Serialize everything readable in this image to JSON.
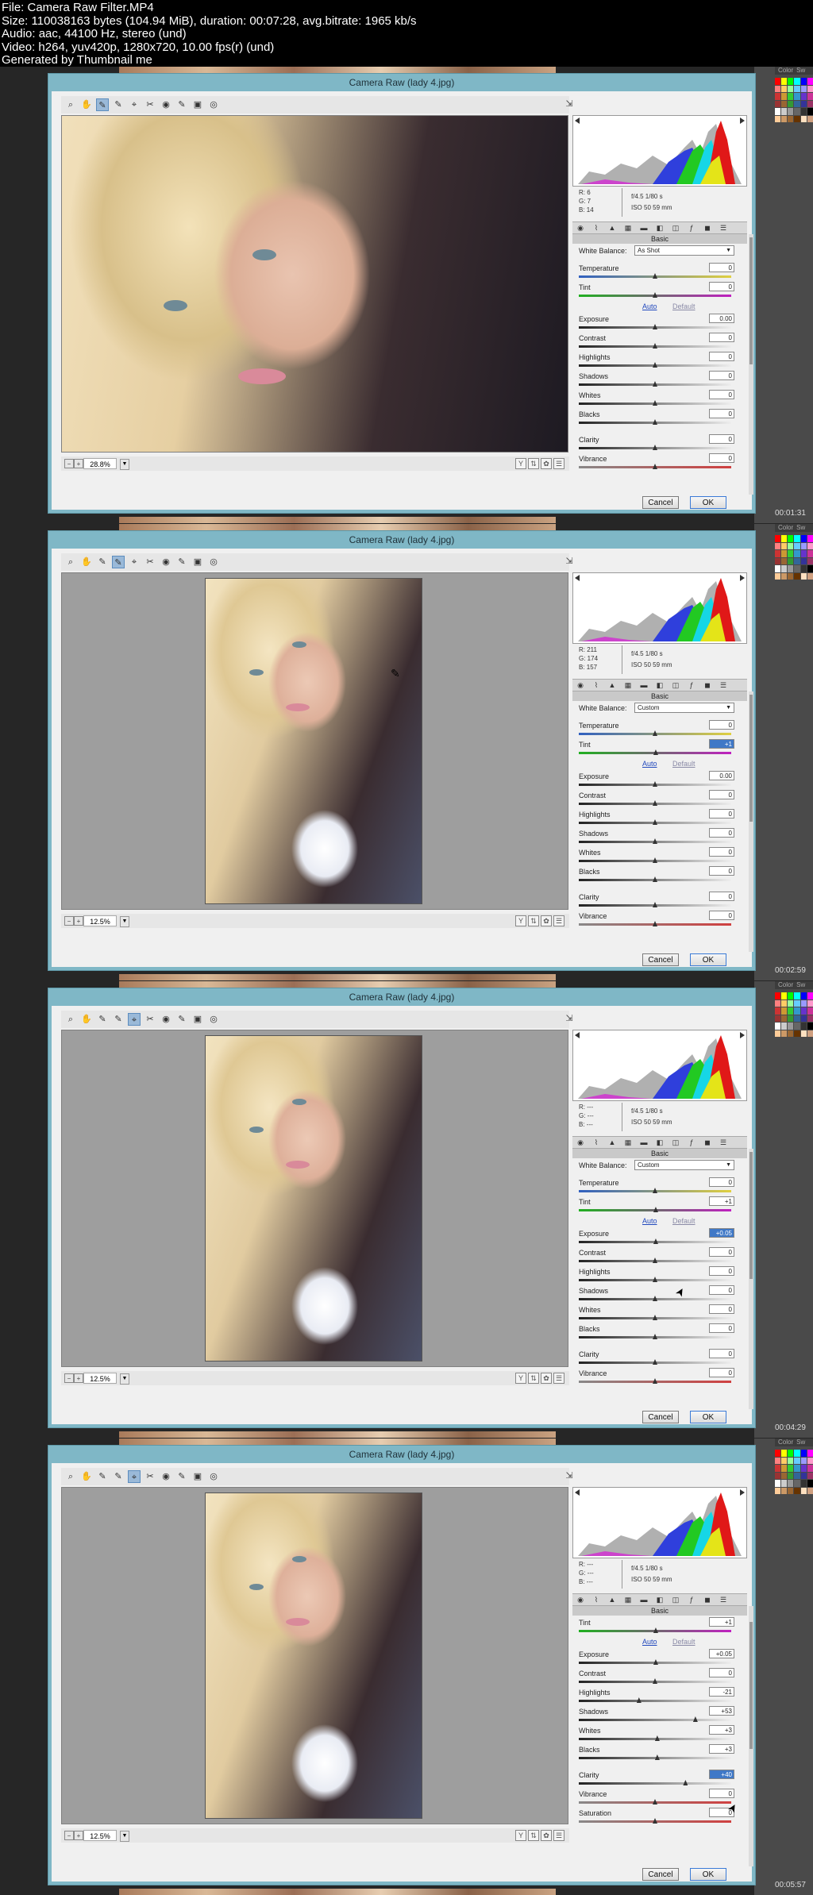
{
  "info": {
    "line1": "File: Camera Raw Filter.MP4",
    "line2": "Size: 110038163 bytes (104.94 MiB), duration: 00:07:28, avg.bitrate: 1965 kb/s",
    "line3": "Audio: aac, 44100 Hz, stereo (und)",
    "line4": "Video: h264, yuv420p, 1280x720, 10.00 fps(r) (und)",
    "line5": "Generated by Thumbnail me"
  },
  "ps_tabs": {
    "color": "Color",
    "swatches": "Sw"
  },
  "frames": [
    {
      "title": "Camera Raw (lady 4.jpg)",
      "timestamp": "00:01:31",
      "zoom": "28.8%",
      "rgb": {
        "r": "R: 6",
        "g": "G: 7",
        "b": "B: 14"
      },
      "cam": {
        "line1": "f/4.5  1/80 s",
        "line2": "ISO 50  59 mm"
      },
      "section": "Basic",
      "white_balance": {
        "label": "White Balance:",
        "value": "As Shot"
      },
      "auto": "Auto",
      "default": "Default",
      "rows": [
        {
          "label": "Temperature",
          "value": "0"
        },
        {
          "label": "Tint",
          "value": "0"
        },
        {
          "label": "Exposure",
          "value": "0.00"
        },
        {
          "label": "Contrast",
          "value": "0"
        },
        {
          "label": "Highlights",
          "value": "0"
        },
        {
          "label": "Shadows",
          "value": "0"
        },
        {
          "label": "Whites",
          "value": "0"
        },
        {
          "label": "Blacks",
          "value": "0"
        },
        {
          "label": "Clarity",
          "value": "0"
        },
        {
          "label": "Vibrance",
          "value": "0"
        }
      ],
      "cancel": "Cancel",
      "ok": "OK"
    },
    {
      "title": "Camera Raw (lady 4.jpg)",
      "timestamp": "00:02:59",
      "zoom": "12.5%",
      "rgb": {
        "r": "R: 211",
        "g": "G: 174",
        "b": "B: 157"
      },
      "cam": {
        "line1": "f/4.5  1/80 s",
        "line2": "ISO 50  59 mm"
      },
      "section": "Basic",
      "white_balance": {
        "label": "White Balance:",
        "value": "Custom"
      },
      "auto": "Auto",
      "default": "Default",
      "rows": [
        {
          "label": "Temperature",
          "value": "0"
        },
        {
          "label": "Tint",
          "value": "+1"
        },
        {
          "label": "Exposure",
          "value": "0.00"
        },
        {
          "label": "Contrast",
          "value": "0"
        },
        {
          "label": "Highlights",
          "value": "0"
        },
        {
          "label": "Shadows",
          "value": "0"
        },
        {
          "label": "Whites",
          "value": "0"
        },
        {
          "label": "Blacks",
          "value": "0"
        },
        {
          "label": "Clarity",
          "value": "0"
        },
        {
          "label": "Vibrance",
          "value": "0"
        }
      ],
      "cancel": "Cancel",
      "ok": "OK"
    },
    {
      "title": "Camera Raw (lady 4.jpg)",
      "timestamp": "00:04:29",
      "zoom": "12.5%",
      "rgb": {
        "r": "R: ---",
        "g": "G: ---",
        "b": "B: ---"
      },
      "cam": {
        "line1": "f/4.5  1/80 s",
        "line2": "ISO 50  59 mm"
      },
      "section": "Basic",
      "white_balance": {
        "label": "White Balance:",
        "value": "Custom"
      },
      "auto": "Auto",
      "default": "Default",
      "rows": [
        {
          "label": "Temperature",
          "value": "0"
        },
        {
          "label": "Tint",
          "value": "+1"
        },
        {
          "label": "Exposure",
          "value": "+0.05"
        },
        {
          "label": "Contrast",
          "value": "0"
        },
        {
          "label": "Highlights",
          "value": "0"
        },
        {
          "label": "Shadows",
          "value": "0"
        },
        {
          "label": "Whites",
          "value": "0"
        },
        {
          "label": "Blacks",
          "value": "0"
        },
        {
          "label": "Clarity",
          "value": "0"
        },
        {
          "label": "Vibrance",
          "value": "0"
        }
      ],
      "cancel": "Cancel",
      "ok": "OK"
    },
    {
      "title": "Camera Raw (lady 4.jpg)",
      "timestamp": "00:05:57",
      "zoom": "12.5%",
      "rgb": {
        "r": "R: ---",
        "g": "G: ---",
        "b": "B: ---"
      },
      "cam": {
        "line1": "f/4.5  1/80 s",
        "line2": "ISO 50  59 mm"
      },
      "section": "Basic",
      "auto": "Auto",
      "default": "Default",
      "rows": [
        {
          "label": "Tint",
          "value": "+1"
        },
        {
          "label": "Exposure",
          "value": "+0.05"
        },
        {
          "label": "Contrast",
          "value": "0"
        },
        {
          "label": "Highlights",
          "value": "-21"
        },
        {
          "label": "Shadows",
          "value": "+53"
        },
        {
          "label": "Whites",
          "value": "+3"
        },
        {
          "label": "Blacks",
          "value": "+3"
        },
        {
          "label": "Clarity",
          "value": "+40"
        },
        {
          "label": "Vibrance",
          "value": "0"
        },
        {
          "label": "Saturation",
          "value": "0"
        }
      ],
      "cancel": "Cancel",
      "ok": "OK"
    }
  ]
}
